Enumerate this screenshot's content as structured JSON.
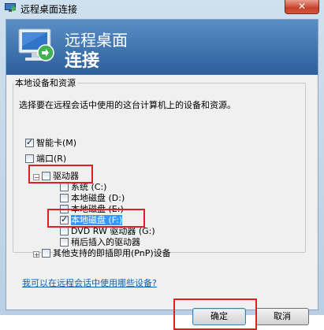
{
  "window": {
    "title": "远程桌面连接",
    "close_label": "✕"
  },
  "header": {
    "line1": "远程桌面",
    "line2": "连接"
  },
  "group": {
    "legend": "本地设备和资源",
    "description": "选择要在远程会话中使用的这台计算机上的设备和资源。"
  },
  "devices": [
    {
      "label": "智能卡(M)",
      "checked": true
    },
    {
      "label": "端口(R)",
      "checked": false
    },
    {
      "label": "驱动器",
      "checked": false,
      "expanded": true
    },
    {
      "label": "系统 (C:)",
      "checked": false
    },
    {
      "label": "本地磁盘 (D:)",
      "checked": false
    },
    {
      "label": "本地磁盘 (E:)",
      "checked": false
    },
    {
      "label": "本地磁盘 (F:)",
      "checked": true,
      "selected": true
    },
    {
      "label": "DVD RW 驱动器 (G:)",
      "checked": false
    },
    {
      "label": "稍后插入的驱动器",
      "checked": false
    },
    {
      "label": "其他支持的即插即用(PnP)设备",
      "checked": false,
      "expanded": false
    }
  ],
  "help_link": "我可以在远程会话中使用哪些设备?",
  "buttons": {
    "ok": "确定",
    "cancel": "取消"
  },
  "icons": [
    "remote-desktop-icon",
    "monitor-icon",
    "close-icon",
    "expand-minus-icon",
    "expand-plus-icon",
    "checkbox"
  ],
  "colors": {
    "header_top": "#5a8ec6",
    "header_bottom": "#2c5f9c",
    "selection": "#3399ff",
    "annotation_red": "#e02020",
    "link": "#0f5faf"
  }
}
